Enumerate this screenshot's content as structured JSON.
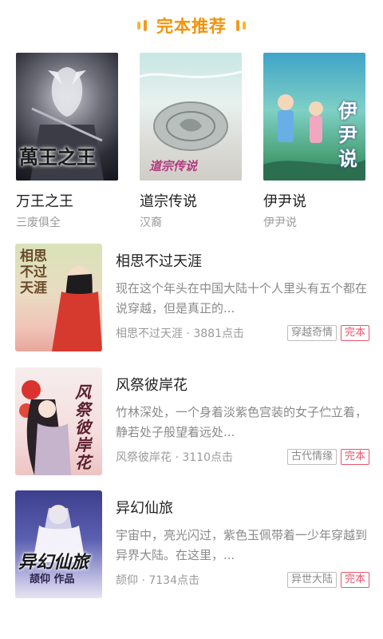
{
  "section": {
    "title": "完本推荐"
  },
  "top_books": [
    {
      "title": "万王之王",
      "author": "三废俱全",
      "cover_text": "萬王之王"
    },
    {
      "title": "道宗传说",
      "author": "汉裔",
      "cover_text": "道宗传说"
    },
    {
      "title": "伊尹说",
      "author": "伊尹说",
      "cover_text": "伊尹说"
    }
  ],
  "list_books": [
    {
      "title": "相思不过天涯",
      "desc": "现在这个年头在中国大陆十个人里头有五个都在说穿越，但是真正的...",
      "byline": "相思不过天涯 · 3881点击",
      "genre": "穿越奇情",
      "status": "完本",
      "cover_text": "相思不过天涯"
    },
    {
      "title": "风祭彼岸花",
      "desc": "竹林深处，一个身着淡紫色宫装的女子伫立着，静若处子般望着远处...",
      "byline": "风祭彼岸花 · 3110点击",
      "genre": "古代情缘",
      "status": "完本",
      "cover_text": "风祭彼岸花"
    },
    {
      "title": "异幻仙旅",
      "desc": "宇宙中，亮光闪过，紫色玉佩带着一少年穿越到异界大陆。在这里，...",
      "byline": "颉仰 · 7134点击",
      "genre": "异世大陆",
      "status": "完本",
      "cover_text": "异幻仙旅",
      "cover_author": "颉仰 作品"
    }
  ]
}
